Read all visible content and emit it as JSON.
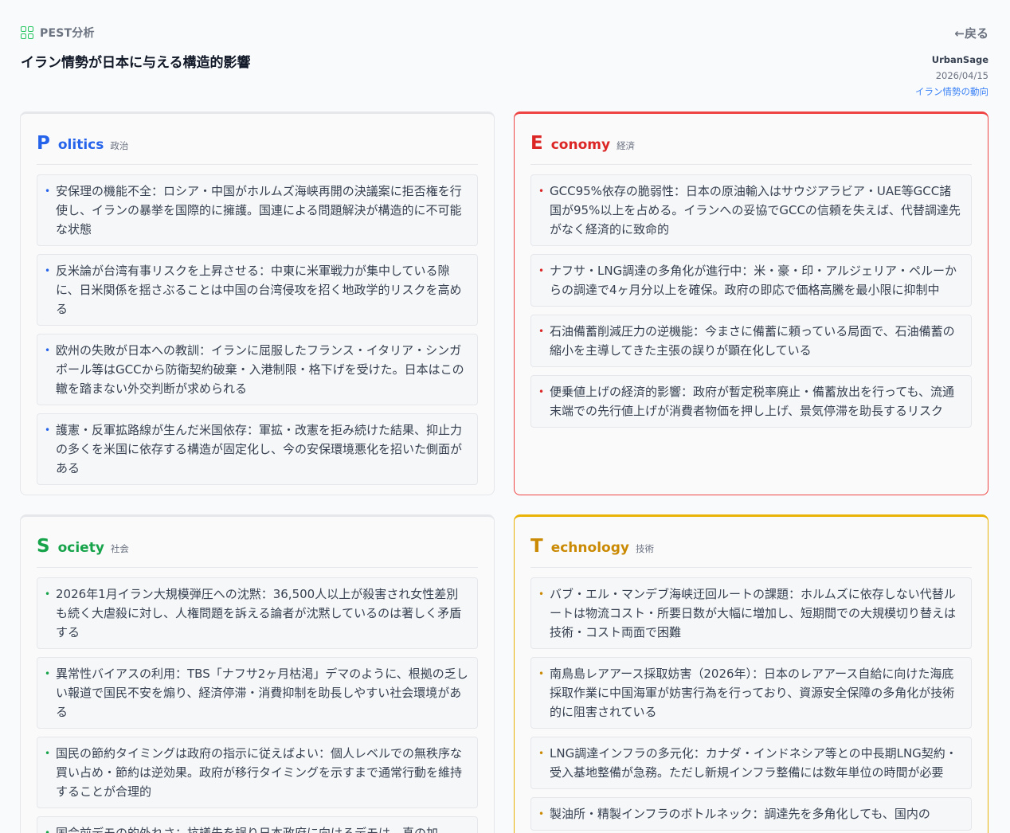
{
  "header": {
    "kind_icon": "grid-icon",
    "kind_label": "PEST分析",
    "title": "イラン情勢が日本に与える構造的影響",
    "back_label": "←戻る",
    "author": "UrbanSage",
    "date": "2026/04/15",
    "tag": "イラン情勢の動向"
  },
  "colors": {
    "politics": "#2563eb",
    "economy": "#dc2626",
    "society": "#16a34a",
    "technology": "#ca8a04"
  },
  "sections": {
    "politics": {
      "letter": "P",
      "rest": "olitics",
      "jp": "政治",
      "items": [
        "安保理の機能不全：ロシア・中国がホルムズ海峡再開の決議案に拒否権を行使し、イランの暴挙を国際的に擁護。国連による問題解決が構造的に不可能な状態",
        "反米論が台湾有事リスクを上昇させる：中東に米軍戦力が集中している隙に、日米関係を揺さぶることは中国の台湾侵攻を招く地政学的リスクを高める",
        "欧州の失敗が日本への教訓：イランに屈服したフランス・イタリア・シンガポール等はGCCから防衛契約破棄・入港制限・格下げを受けた。日本はこの轍を踏まない外交判断が求められる",
        "護憲・反軍拡路線が生んだ米国依存：軍拡・改憲を拒み続けた結果、抑止力の多くを米国に依存する構造が固定化し、今の安保環境悪化を招いた側面がある"
      ]
    },
    "economy": {
      "letter": "E",
      "rest": "conomy",
      "jp": "経済",
      "items": [
        "GCC95%依存の脆弱性：日本の原油輸入はサウジアラビア・UAE等GCC諸国が95%以上を占める。イランへの妥協でGCCの信頼を失えば、代替調達先がなく経済的に致命的",
        "ナフサ・LNG調達の多角化が進行中：米・豪・印・アルジェリア・ペルーからの調達で4ヶ月分以上を確保。政府の即応で価格高騰を最小限に抑制中",
        "石油備蓄削減圧力の逆機能：今まさに備蓄に頼っている局面で、石油備蓄の縮小を主導してきた主張の誤りが顕在化している",
        "便乗値上げの経済的影響：政府が暫定税率廃止・備蓄放出を行っても、流通末端での先行値上げが消費者物価を押し上げ、景気停滞を助長するリスク"
      ]
    },
    "society": {
      "letter": "S",
      "rest": "ociety",
      "jp": "社会",
      "items": [
        "2026年1月イラン大規模弾圧への沈黙：36,500人以上が殺害され女性差別も続く大虐殺に対し、人権問題を訴える論者が沈黙しているのは著しく矛盾する",
        "異常性バイアスの利用：TBS「ナフサ2ヶ月枯渇」デマのように、根拠の乏しい報道で国民不安を煽り、経済停滞・消費抑制を助長しやすい社会環境がある",
        "国民の節約タイミングは政府の指示に従えばよい：個人レベルでの無秩序な買い占め・節約は逆効果。政府が移行タイミングを示すまで通常行動を維持することが合理的",
        "国会前デモの的外れさ：抗議先を誤り日本政府に向けるデモは、真の加"
      ]
    },
    "technology": {
      "letter": "T",
      "rest": "echnology",
      "jp": "技術",
      "items": [
        "バブ・エル・マンデブ海峡迂回ルートの課題：ホルムズに依存しない代替ルートは物流コスト・所要日数が大幅に増加し、短期間での大規模切り替えは技術・コスト両面で困難",
        "南鳥島レアアース採取妨害（2026年）：日本のレアアース自給に向けた海底採取作業に中国海軍が妨害行為を行っており、資源安全保障の多角化が技術的に阻害されている",
        "LNG調達インフラの多元化：カナダ・インドネシア等との中長期LNG契約・受入基地整備が急務。ただし新規インフラ整備には数年単位の時間が必要",
        "製油所・精製インフラのボトルネック：調達先を多角化しても、国内の"
      ]
    }
  }
}
